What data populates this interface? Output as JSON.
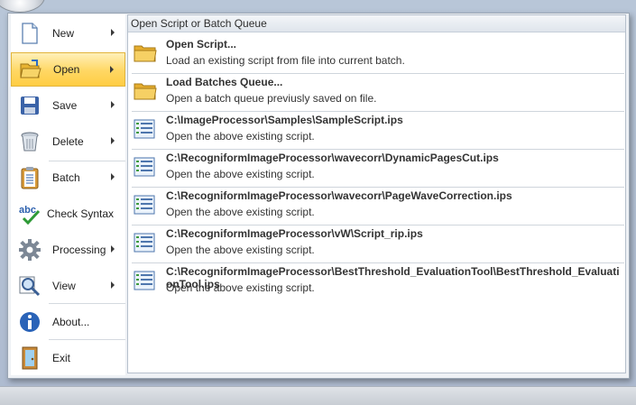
{
  "left_menu": {
    "items": [
      {
        "label": "New",
        "icon": "new-document-icon",
        "submenu": true
      },
      {
        "label": "Open",
        "icon": "open-folder-icon",
        "submenu": true,
        "active": true
      },
      {
        "label": "Save",
        "icon": "floppy-disk-icon",
        "submenu": true
      },
      {
        "label": "Delete",
        "icon": "trash-bin-icon",
        "submenu": true
      },
      {
        "label": "Batch",
        "icon": "clipboard-list-icon",
        "submenu": true
      },
      {
        "label": "Check Syntax",
        "icon": "spell-check-icon",
        "submenu": false
      },
      {
        "label": "Processing",
        "icon": "gear-icon",
        "submenu": true
      },
      {
        "label": "View",
        "icon": "magnifier-icon",
        "submenu": true
      },
      {
        "label": "About...",
        "icon": "info-icon",
        "submenu": false
      },
      {
        "label": "Exit",
        "icon": "exit-door-icon",
        "submenu": false
      }
    ]
  },
  "panel": {
    "header": "Open Script or Batch Queue",
    "entries": [
      {
        "title": "Open Script...",
        "desc": "Load an existing script from file into current batch.",
        "icon": "folder-icon"
      },
      {
        "title": "Load Batches Queue...",
        "desc": "Open a batch queue previusly saved on file.",
        "icon": "folder-icon"
      },
      {
        "title": "C:\\ImageProcessor\\Samples\\SampleScript.ips",
        "desc": "Open the above existing script.",
        "icon": "script-list-icon"
      },
      {
        "title": "C:\\RecogniformImageProcessor\\wavecorr\\DynamicPagesCut.ips",
        "desc": "Open the above existing script.",
        "icon": "script-list-icon"
      },
      {
        "title": "C:\\RecogniformImageProcessor\\wavecorr\\PageWaveCorrection.ips",
        "desc": "Open the above existing script.",
        "icon": "script-list-icon"
      },
      {
        "title": "C:\\RecogniformImageProcessor\\vW\\Script_rip.ips",
        "desc": "Open the above existing script.",
        "icon": "script-list-icon"
      },
      {
        "title": "C:\\RecogniformImageProcessor\\BestThreshold_EvaluationTool\\BestThreshold_EvaluationTool.ips",
        "desc": "Open the above existing script.",
        "icon": "script-list-icon"
      }
    ]
  },
  "colors": {
    "active_highlight": "#ffd763",
    "panel_header_bg": "#dfe5ec",
    "folder_yellow": "#f4c542",
    "script_green": "#3f9a3f"
  }
}
